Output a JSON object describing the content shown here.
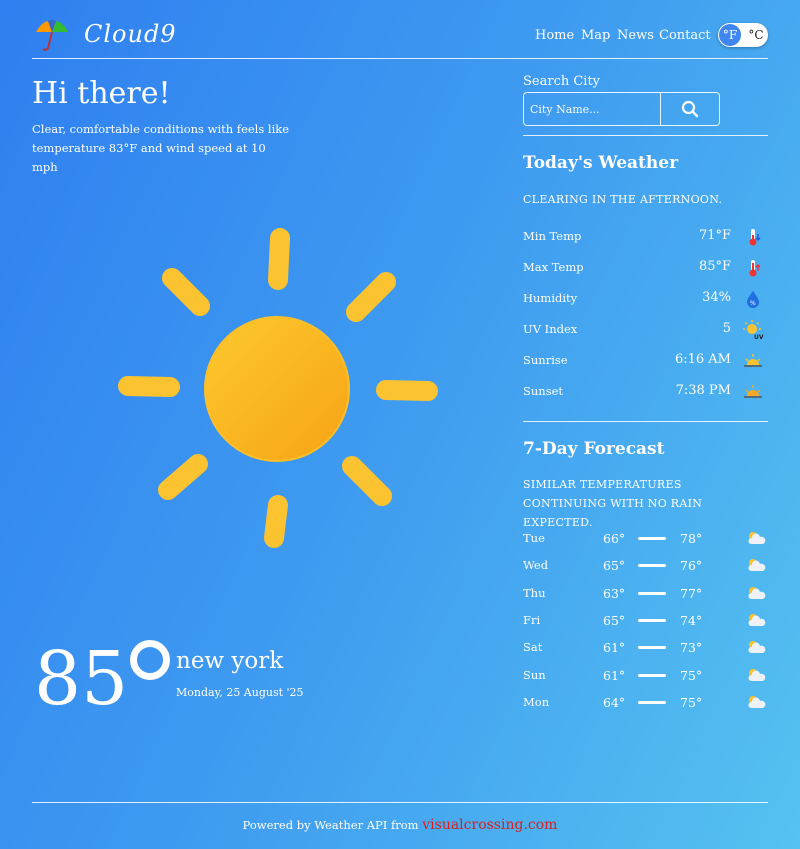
{
  "header": {
    "brand": "Cloud9",
    "nav": [
      "Home",
      "Map",
      "News",
      "Contact"
    ],
    "unit_f": "°F",
    "unit_c": "°C"
  },
  "hero": {
    "greeting": "Hi there!",
    "description": "Clear, comfortable conditions with feels like temperature 83°F and wind speed at 10 mph",
    "temperature": "85",
    "city": "new york",
    "date": "Monday, 25 August '25"
  },
  "search": {
    "label": "Search City",
    "placeholder": "City Name..."
  },
  "today": {
    "title": "Today's Weather",
    "summary": "CLEARING IN THE AFTERNOON.",
    "stats": [
      {
        "label": "Min Temp",
        "value": "71°F",
        "icon": "thermometer-cold-icon"
      },
      {
        "label": "Max Temp",
        "value": "85°F",
        "icon": "thermometer-hot-icon"
      },
      {
        "label": "Humidity",
        "value": "34%",
        "icon": "humidity-drop-icon"
      },
      {
        "label": "UV Index",
        "value": "5",
        "icon": "uv-sun-icon"
      },
      {
        "label": "Sunrise",
        "value": "6:16 AM",
        "icon": "sunrise-icon"
      },
      {
        "label": "Sunset",
        "value": "7:38 PM",
        "icon": "sunset-icon"
      }
    ]
  },
  "forecast": {
    "title": "7-Day Forecast",
    "summary": "SIMILAR TEMPERATURES CONTINUING WITH NO RAIN EXPECTED.",
    "days": [
      {
        "day": "Tue",
        "lo": "66°",
        "hi": "78°"
      },
      {
        "day": "Wed",
        "lo": "65°",
        "hi": "76°"
      },
      {
        "day": "Thu",
        "lo": "63°",
        "hi": "77°"
      },
      {
        "day": "Fri",
        "lo": "65°",
        "hi": "74°"
      },
      {
        "day": "Sat",
        "lo": "61°",
        "hi": "73°"
      },
      {
        "day": "Sun",
        "lo": "61°",
        "hi": "75°"
      },
      {
        "day": "Mon",
        "lo": "64°",
        "hi": "75°"
      }
    ]
  },
  "footer": {
    "text": "Powered by Weather API from",
    "link": "visualcrossing.com",
    "link_color": "#d42020"
  }
}
